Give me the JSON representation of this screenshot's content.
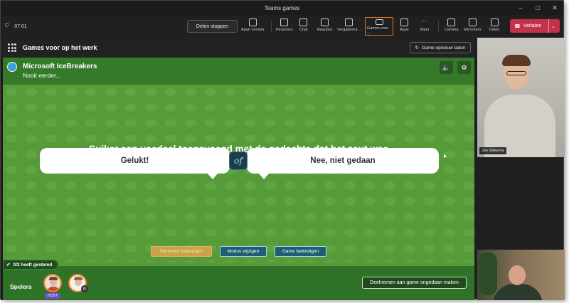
{
  "window": {
    "title": "Teams games",
    "controls": [
      "–",
      "□",
      "✕"
    ]
  },
  "toolbar": {
    "timer": "07:01",
    "stop_sharing": "Delen stoppen",
    "buttons": [
      {
        "label": "Apart venster",
        "icon": "popout-icon"
      },
      {
        "label": "Personen",
        "icon": "people-icon"
      },
      {
        "label": "Chat",
        "icon": "chat-icon"
      },
      {
        "label": "Reacties",
        "icon": "reactions-icon"
      },
      {
        "label": "Vergaderrui...",
        "icon": "rooms-icon"
      },
      {
        "label": "Games voor ...",
        "icon": "games-icon"
      },
      {
        "label": "Apps",
        "icon": "apps-icon"
      },
      {
        "label": "Meer",
        "icon": "more-icon"
      },
      {
        "label": "Camera",
        "icon": "camera-icon"
      },
      {
        "label": "Microfoon",
        "icon": "mic-icon"
      },
      {
        "label": "Delen",
        "icon": "share-icon"
      }
    ],
    "leave": "Verlaten"
  },
  "stage": {
    "header_title": "Games voor op het werk",
    "reload": "Game opnieuw laden"
  },
  "game": {
    "title": "Microsoft IceBreakers",
    "subtitle": "Nooit eerder...",
    "question": "Suiker aan voedsel toegevoegd met de gedachte dat het zout was",
    "answer_left": "Gelukt!",
    "answer_right": "Nee, niet gedaan",
    "badge": "of",
    "actions": {
      "stop_voting": "Stemmen beëindigen",
      "change_mode": "Modus wijzigen",
      "end_game": "Game beëindigen"
    },
    "voted": "0/2 heeft gestemd",
    "players_label": "Spelers",
    "host_tag": "HOST",
    "undo_join": "Deelnemen aan game ongedaan maken"
  },
  "participants": [
    {
      "name": "Jan Sikkema"
    }
  ]
}
